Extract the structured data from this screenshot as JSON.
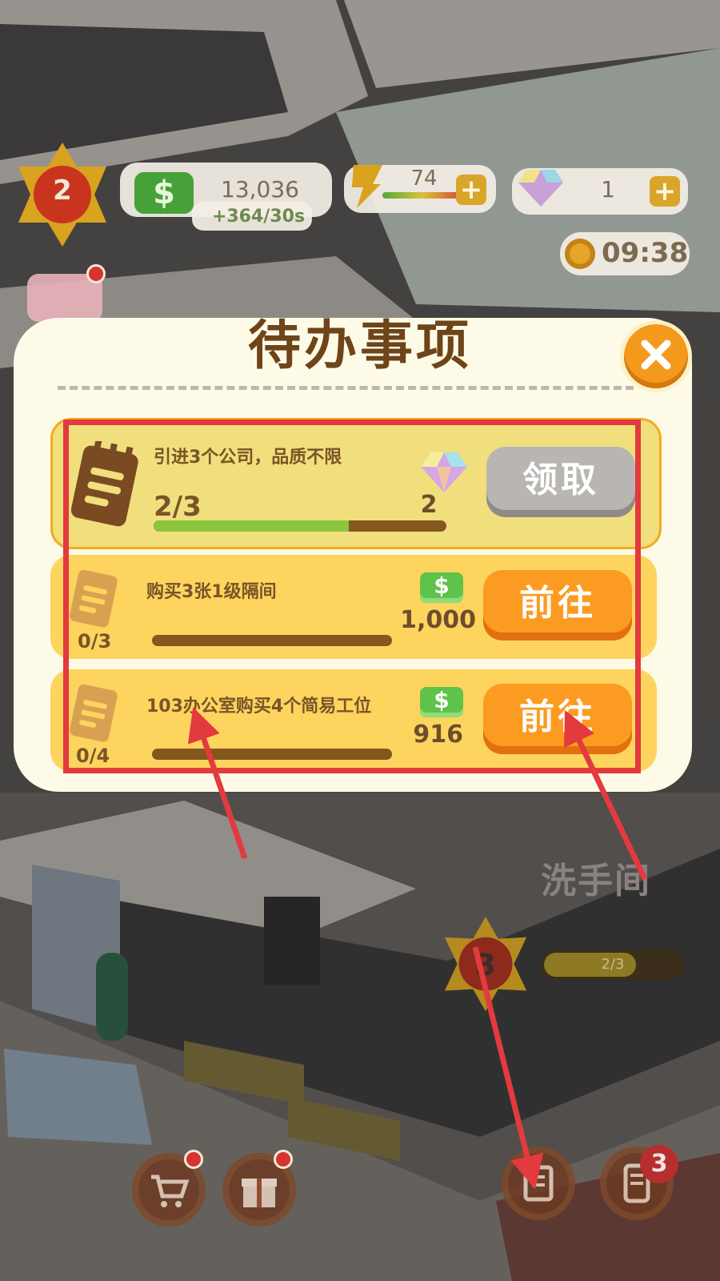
{
  "hud": {
    "level": "2",
    "cash_icon": "$",
    "cash": "13,036",
    "cash_rate": "+364/30s",
    "energy": "74",
    "gems": "1",
    "timer": "09:38",
    "plus": "+"
  },
  "dialog": {
    "title": "待办事项",
    "tasks": [
      {
        "title": "引进3个公司，品质不限",
        "progress_text": "2/3",
        "progress": 0.667,
        "reward_type": "gem",
        "reward_amount": "2",
        "button": "领取",
        "button_state": "claim"
      },
      {
        "title": "购买3张1级隔间",
        "progress_text": "0/3",
        "progress": 0,
        "reward_type": "cash",
        "reward_icon": "$",
        "reward_amount": "1,000",
        "button": "前往",
        "button_state": "go"
      },
      {
        "title": "103办公室购买4个简易工位",
        "progress_text": "0/4",
        "progress": 0,
        "reward_type": "cash",
        "reward_icon": "$",
        "reward_amount": "916",
        "button": "前往",
        "button_state": "go"
      }
    ]
  },
  "room": {
    "label": "洗手间",
    "level": "3",
    "progress_text": "2/3",
    "progress": 0.667
  },
  "bottom_bar": {
    "badge_count": "3"
  },
  "colors": {
    "annotation_red": "#e23a3e",
    "button_orange": "#fc9b22",
    "button_grey": "#b9b6b2",
    "title_brown": "#6e4419"
  }
}
